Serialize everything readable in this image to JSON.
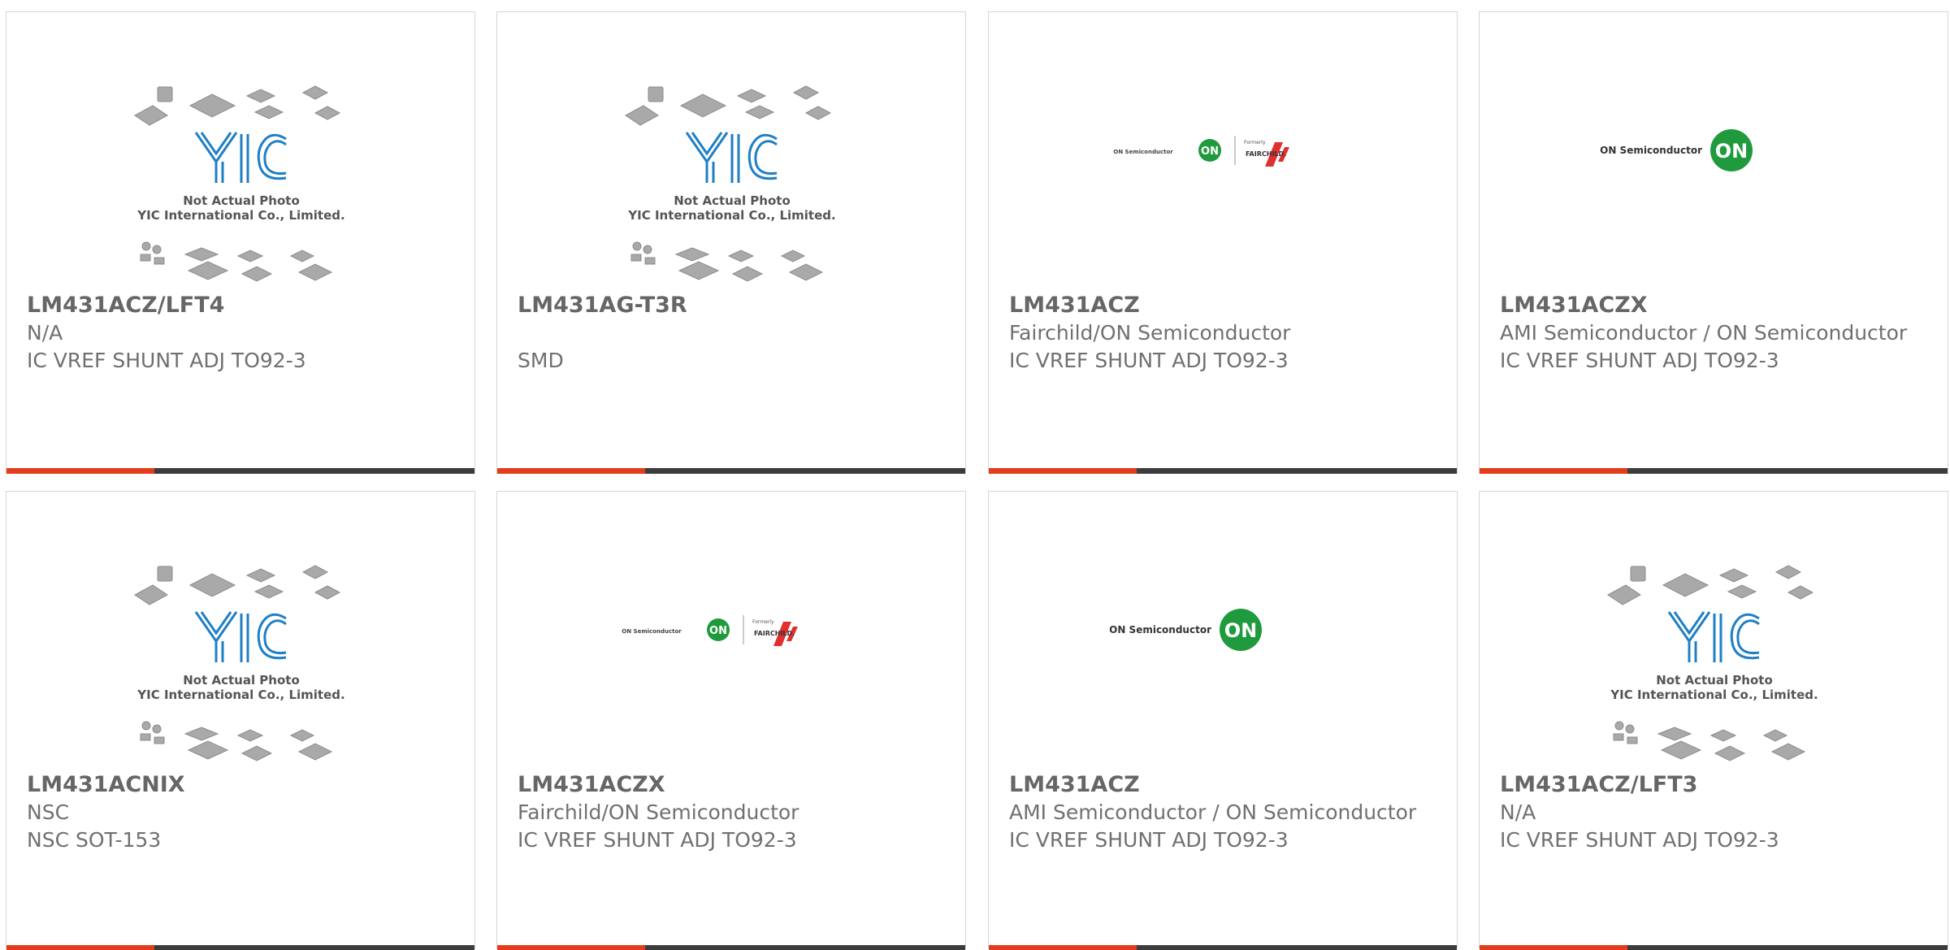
{
  "colors": {
    "accent": "#e33d1c",
    "bar": "#3c3c3c",
    "border": "#d6d6d6",
    "text": "#707070",
    "yic_blue": "#1f7fc4",
    "on_green": "#1f9a3c",
    "fairchild_red": "#e0302d"
  },
  "placeholder": {
    "line1": "Not Actual Photo",
    "line2": "YIC International Co., Limited."
  },
  "logos": {
    "on_semi_text": "ON Semiconductor",
    "on_mark": "ON",
    "formerly": "Formerly",
    "fairchild": "FAIRCHILD."
  },
  "products": [
    {
      "part_number": "LM431ACZ/LFT4",
      "manufacturer": "N/A",
      "description": "IC VREF SHUNT ADJ TO92-3",
      "image": "yic-placeholder"
    },
    {
      "part_number": "LM431AG-T3R",
      "manufacturer": "",
      "description": "SMD",
      "image": "yic-placeholder"
    },
    {
      "part_number": "LM431ACZ",
      "manufacturer": "Fairchild/ON Semiconductor",
      "description": "IC VREF SHUNT ADJ TO92-3",
      "image": "on-fairchild-logo"
    },
    {
      "part_number": "LM431ACZX",
      "manufacturer": "AMI Semiconductor / ON Semiconductor",
      "description": "IC VREF SHUNT ADJ TO92-3",
      "image": "on-semi-logo"
    },
    {
      "part_number": "LM431ACNIX",
      "manufacturer": "NSC",
      "description": "NSC SOT-153",
      "image": "yic-placeholder"
    },
    {
      "part_number": "LM431ACZX",
      "manufacturer": "Fairchild/ON Semiconductor",
      "description": "IC VREF SHUNT ADJ TO92-3",
      "image": "on-fairchild-logo"
    },
    {
      "part_number": "LM431ACZ",
      "manufacturer": "AMI Semiconductor / ON Semiconductor",
      "description": "IC VREF SHUNT ADJ TO92-3",
      "image": "on-semi-logo"
    },
    {
      "part_number": "LM431ACZ/LFT3",
      "manufacturer": "N/A",
      "description": "IC VREF SHUNT ADJ TO92-3",
      "image": "yic-placeholder"
    }
  ]
}
